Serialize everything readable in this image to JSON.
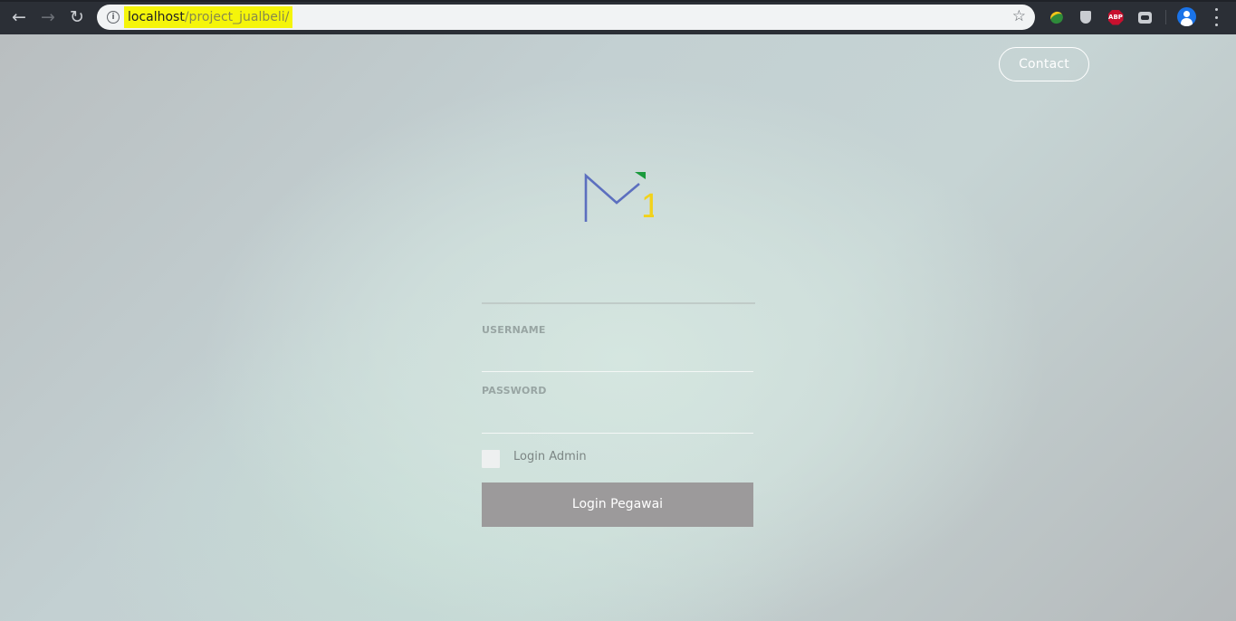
{
  "browser": {
    "url_host": "localhost",
    "url_path": "/project_jualbeli/",
    "highlight_color": "#f5f50a"
  },
  "header": {
    "contact_label": "Contact"
  },
  "login_form": {
    "username_label": "USERNAME",
    "username_value": "",
    "password_label": "PASSWORD",
    "password_value": "",
    "admin_checkbox_label": "Login Admin",
    "admin_checkbox_checked": false,
    "submit_label": "Login Pegawai"
  },
  "logo": {
    "digit": "1",
    "colors": {
      "letter": "#5c6fbf",
      "digit": "#f2d21a",
      "flag": "#1a9a3c"
    }
  }
}
